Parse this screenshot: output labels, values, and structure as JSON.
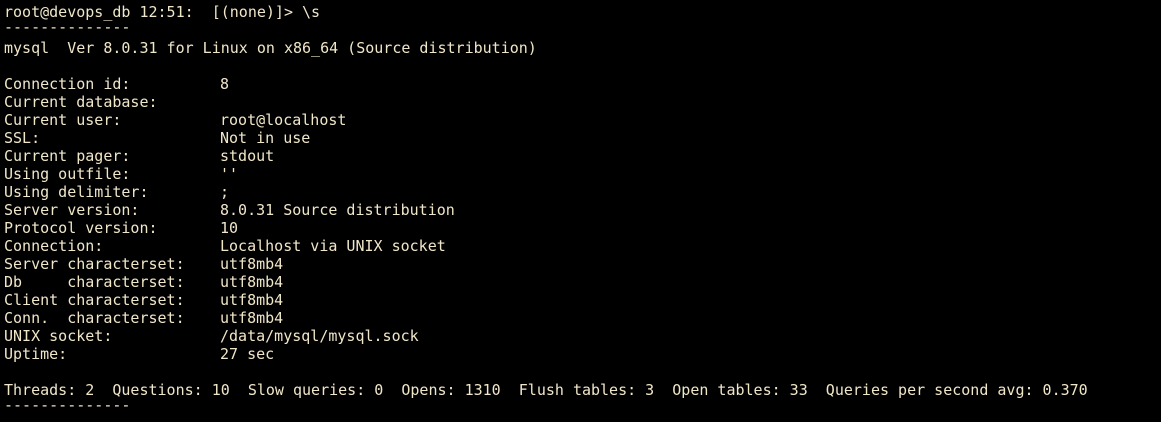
{
  "prompt": {
    "text": "root@devops_db 12:51:  [(none)]> ",
    "command": "\\s"
  },
  "separator": "--------------",
  "version_line": "mysql  Ver 8.0.31 for Linux on x86_64 (Source distribution)",
  "status_rows": [
    {
      "label": "Connection id:",
      "value": "8"
    },
    {
      "label": "Current database:",
      "value": ""
    },
    {
      "label": "Current user:",
      "value": "root@localhost"
    },
    {
      "label": "SSL:",
      "value": "Not in use"
    },
    {
      "label": "Current pager:",
      "value": "stdout"
    },
    {
      "label": "Using outfile:",
      "value": "''"
    },
    {
      "label": "Using delimiter:",
      "value": ";"
    },
    {
      "label": "Server version:",
      "value": "8.0.31 Source distribution"
    },
    {
      "label": "Protocol version:",
      "value": "10"
    },
    {
      "label": "Connection:",
      "value": "Localhost via UNIX socket"
    },
    {
      "label": "Server characterset:",
      "value": "utf8mb4"
    },
    {
      "label": "Db     characterset:",
      "value": "utf8mb4"
    },
    {
      "label": "Client characterset:",
      "value": "utf8mb4"
    },
    {
      "label": "Conn.  characterset:",
      "value": "utf8mb4"
    },
    {
      "label": "UNIX socket:",
      "value": "/data/mysql/mysql.sock"
    },
    {
      "label": "Uptime:",
      "value": "27 sec"
    }
  ],
  "summary_line": "Threads: 2  Questions: 10  Slow queries: 0  Opens: 1310  Flush tables: 3  Open tables: 33  Queries per second avg: 0.370",
  "colors": {
    "background": "#000000",
    "foreground": "#f0e6c8"
  }
}
